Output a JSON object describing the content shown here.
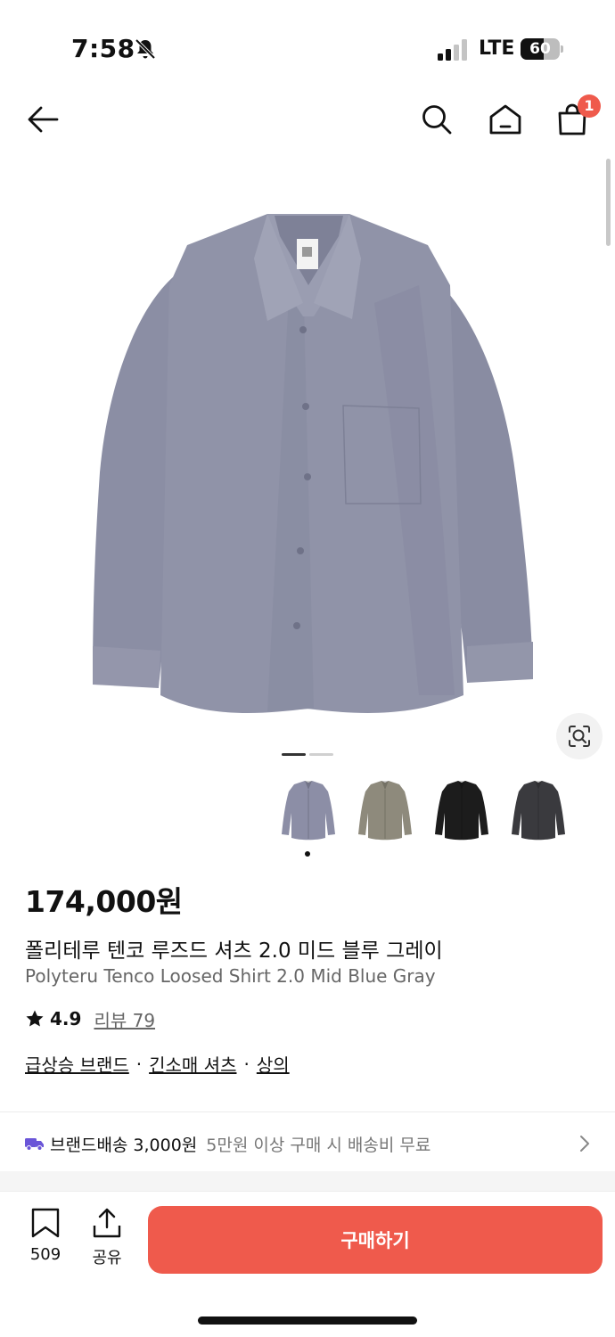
{
  "status_bar": {
    "time": "7:58",
    "carrier": "LTE",
    "battery": "60",
    "battery_level": 0.6
  },
  "nav": {
    "back_icon": "arrow-left-icon",
    "search_icon": "search-icon",
    "home_icon": "home-icon",
    "cart_icon": "shopping-bag-icon",
    "cart_badge": "1"
  },
  "gallery": {
    "image": "gray-shirt-photo",
    "image_count": 2,
    "current_index": 1,
    "lens_icon": "image-search-icon"
  },
  "colors": {
    "options": [
      {
        "name": "Mid Blue Gray",
        "color": "#8c8ea6"
      },
      {
        "name": "khaki",
        "color": "#8e8a7c"
      },
      {
        "name": "black",
        "color": "#1c1c1c"
      },
      {
        "name": "charcoal",
        "color": "#3a3a3e"
      }
    ],
    "selected_index": 0
  },
  "product": {
    "price": "174,000원",
    "name_ko": "폴리테루 텐코 루즈드 셔츠 2.0 미드 블루 그레이",
    "name_en": "Polyteru Tenco Loosed Shirt 2.0 Mid Blue Gray",
    "rating": "4.9",
    "reviews": "리뷰 79",
    "categories": [
      "급상승 브랜드",
      "긴소매 셔츠",
      "상의"
    ],
    "category_sep": "·"
  },
  "delivery": {
    "label": "브랜드배송",
    "fee": "3,000원",
    "note": "5만원 이상 구매 시 배송비 무료"
  },
  "bottom_bar": {
    "bookmark_count": "509",
    "share_label": "공유",
    "buy_label": "구매하기"
  },
  "theme": {
    "accent": "#ef5a4c",
    "delivery_icon_color": "#6a55d8"
  }
}
